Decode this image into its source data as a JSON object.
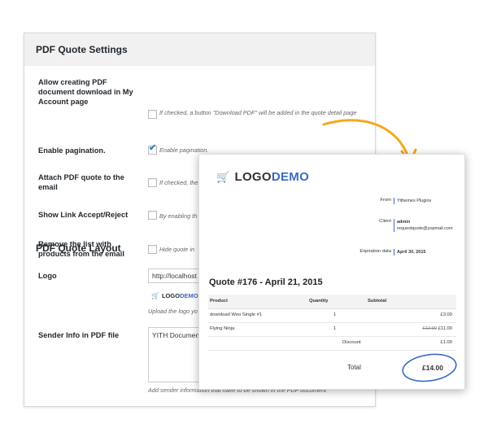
{
  "settings": {
    "section1_title": "PDF Quote Settings",
    "rows": [
      {
        "label": "Allow creating PDF document download in My Account page",
        "checked": false,
        "desc": "If checked, a button \"Download PDF\" will be added in the quote detail page"
      },
      {
        "label": "Enable pagination.",
        "checked": true,
        "desc": "Enable pagination."
      },
      {
        "label": "Attach PDF quote to the email",
        "checked": false,
        "desc": "If checked, the quote will be sent as PDF attachment"
      },
      {
        "label": "Show Link Accept/Reject",
        "checked": false,
        "desc": "By enabling th"
      },
      {
        "label": "Remove the list with products from the email",
        "checked": false,
        "desc": "Hide quote in"
      }
    ],
    "section2_title": "PDF Quote Layout",
    "logo_label": "Logo",
    "logo_value": "http://localhost",
    "logo_preview_a": "LOGO",
    "logo_preview_b": "DEMO",
    "logo_help": "Upload the logo yo",
    "sender_label": "Sender Info in PDF file",
    "sender_value": "YITH Document",
    "sender_help": "Add sender information that have to be shown in the PDF document"
  },
  "pdf": {
    "logo_a": "LOGO",
    "logo_b": "DEMO",
    "from_label": "From",
    "from_value": "Yithemes Plugins",
    "client_label": "Client",
    "client_name": "admin",
    "client_email": "requestquote@yopmail.com",
    "expiration_label": "Expiration data",
    "expiration_value": "April 30, 2015",
    "quote_title": "Quote #176 - April 21, 2015",
    "columns": [
      "Product",
      "Quantity",
      "Subtotal"
    ],
    "items": [
      {
        "product": "download Woo Single #1",
        "qty": "1",
        "old": "",
        "subtotal": "£3.00"
      },
      {
        "product": "Flying Ninja",
        "qty": "1",
        "old": "£12.00",
        "subtotal": "£11.00"
      }
    ],
    "discount_label": "Discount",
    "discount_value": "£1.00",
    "total_label": "Total",
    "total_value": "£14.00"
  },
  "colors": {
    "accent": "#3b6bc4",
    "arrow": "#f4a81d",
    "check": "#1e8cbe"
  }
}
